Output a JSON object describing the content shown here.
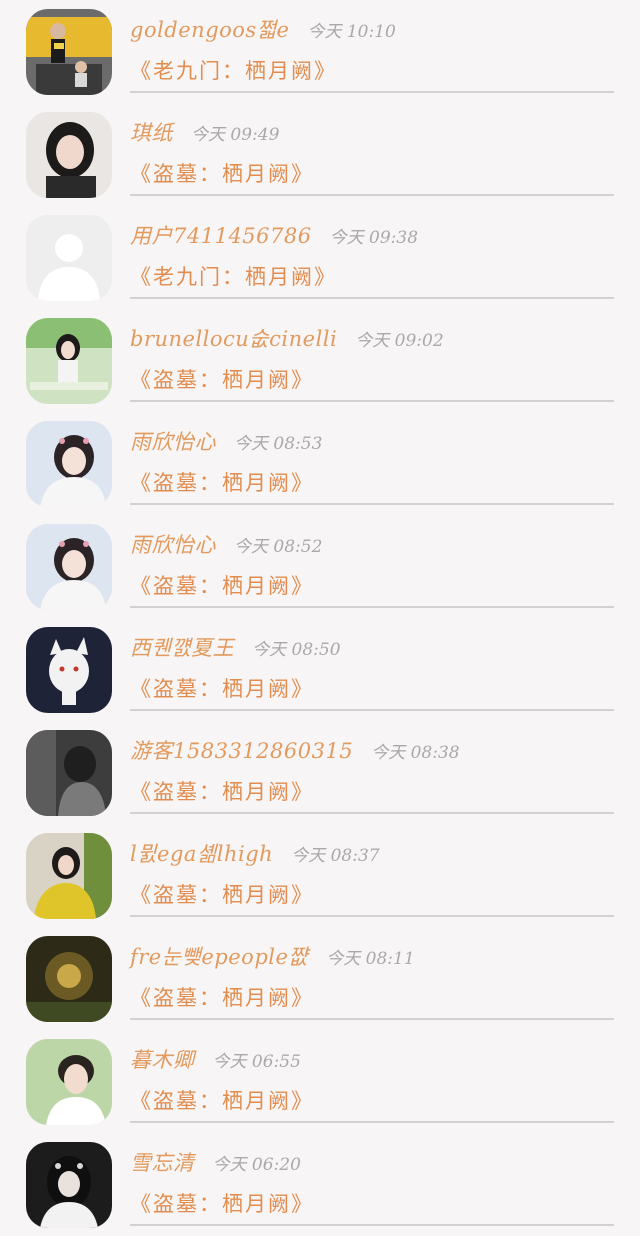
{
  "messages": [
    {
      "username": "goldengoos쩗e",
      "time": "今天 10:10",
      "book": "《老九门：栖月阙》",
      "avatar": "avatar-photo-icon",
      "tone": "#d8b13a"
    },
    {
      "username": "琪纸",
      "time": "今天 09:49",
      "book": "《盗墓：栖月阙》",
      "avatar": "avatar-photo-icon",
      "tone": "#3b2f2f"
    },
    {
      "username": "用户7411456786",
      "time": "今天 09:38",
      "book": "《老九门：栖月阙》",
      "avatar": "default-avatar-icon",
      "tone": "#e6e6e6"
    },
    {
      "username": "brunellocu숪cinelli",
      "time": "今天 09:02",
      "book": "《盗墓：栖月阙》",
      "avatar": "avatar-photo-icon",
      "tone": "#6fa85a"
    },
    {
      "username": "雨欣怡心",
      "time": "今天 08:53",
      "book": "《盗墓：栖月阙》",
      "avatar": "avatar-photo-icon",
      "tone": "#c9d4e6"
    },
    {
      "username": "雨欣怡心",
      "time": "今天 08:52",
      "book": "《盗墓：栖月阙》",
      "avatar": "avatar-photo-icon",
      "tone": "#c9d4e6"
    },
    {
      "username": "西퀜꺬夏王",
      "time": "今天 08:50",
      "book": "《盗墓：栖月阙》",
      "avatar": "avatar-cartoon-icon",
      "tone": "#1f2338"
    },
    {
      "username": "游客1583312860315",
      "time": "今天 08:38",
      "book": "《盗墓：栖月阙》",
      "avatar": "avatar-photo-icon",
      "tone": "#4a4a4a"
    },
    {
      "username": "l뮔ega셺lhigh",
      "time": "今天 08:37",
      "book": "《盗墓：栖月阙》",
      "avatar": "avatar-photo-icon",
      "tone": "#b8b23a"
    },
    {
      "username": "fre눈뺒epeople쨦",
      "time": "今天 08:11",
      "book": "《盗墓：栖月阙》",
      "avatar": "avatar-photo-icon",
      "tone": "#5a4a1c"
    },
    {
      "username": "暮木卿",
      "time": "今天 06:55",
      "book": "《盗墓：栖月阙》",
      "avatar": "avatar-photo-icon",
      "tone": "#9bbf8a"
    },
    {
      "username": "雪忘清",
      "time": "今天 06:20",
      "book": "《盗墓：栖月阙》",
      "avatar": "avatar-photo-icon",
      "tone": "#2a2a2a"
    }
  ],
  "colors": {
    "background": "#f7f5f5",
    "username": "#e29a5e",
    "time": "#a9a9a9",
    "book": "#e28d4f",
    "divider": "#d2d2d2"
  }
}
